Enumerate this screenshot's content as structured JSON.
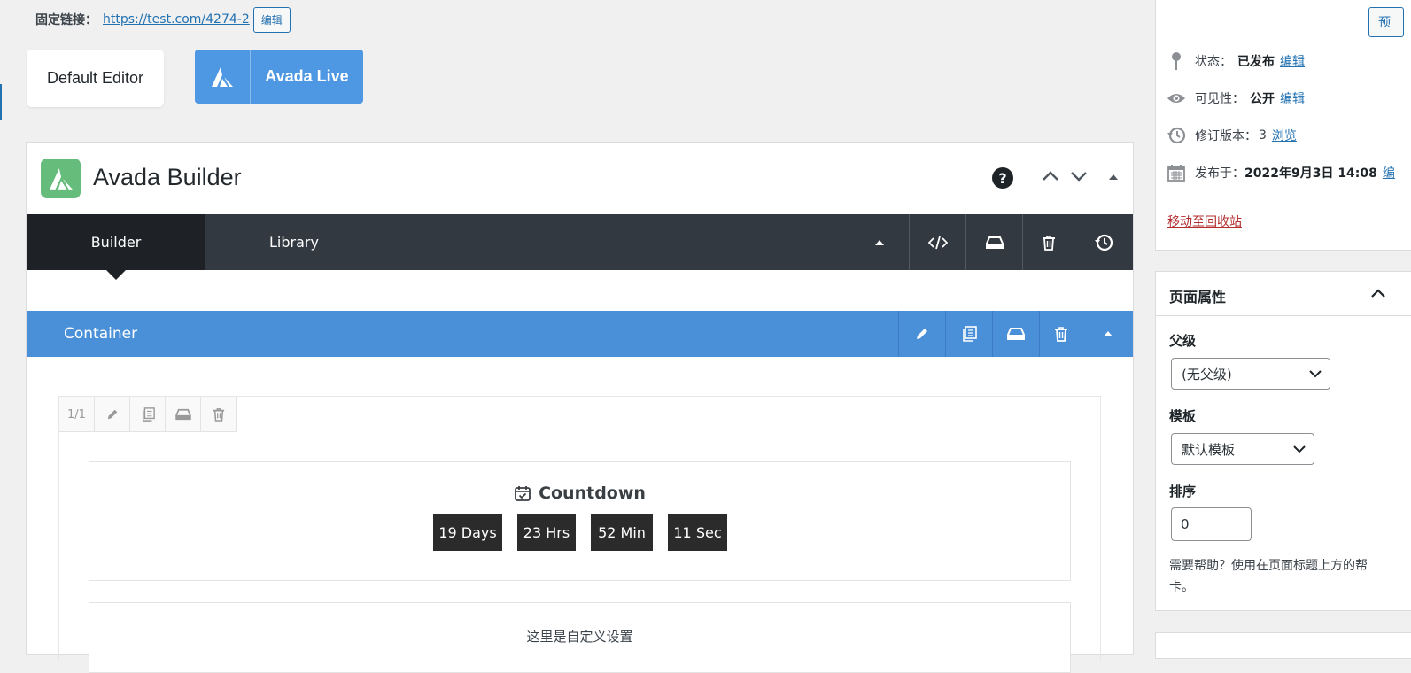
{
  "permalink": {
    "label": "固定链接：",
    "url": "https://test.com/4274-2",
    "edit": "编辑"
  },
  "editor_switch": {
    "default_editor": "Default Editor",
    "avada_live": "Avada Live"
  },
  "builder": {
    "title": "Avada Builder",
    "help": "?",
    "tabs": [
      "Builder",
      "Library"
    ],
    "container_label": "Container",
    "column_size": "1/1"
  },
  "countdown": {
    "title": "Countdown",
    "days": "19 Days",
    "hours": "23 Hrs",
    "minutes": "52 Min",
    "seconds": "11 Sec"
  },
  "custom_element": {
    "text": "这里是自定义设置"
  },
  "publish": {
    "preview": "预",
    "status_label": "状态：",
    "status_value": "已发布",
    "status_edit": "编辑",
    "visibility_label": "可见性：",
    "visibility_value": "公开",
    "visibility_edit": "编辑",
    "revisions_label": "修订版本：",
    "revisions_count": "3",
    "revisions_browse": "浏览",
    "published_label": "发布于：",
    "published_value": "2022年9月3日 14:08",
    "published_edit": "编",
    "trash": "移动至回收站"
  },
  "page_attributes": {
    "title": "页面属性",
    "parent_label": "父级",
    "parent_value": "(无父级)",
    "template_label": "模板",
    "template_value": "默认模板",
    "order_label": "排序",
    "order_value": "0",
    "help_line1": "需要帮助？使用在页面标题上方的帮",
    "help_line2": "卡。"
  },
  "colors": {
    "accent_blue": "#4a90d9",
    "avada_green": "#65bc7b",
    "dark_bar": "#333940",
    "link": "#2271b1",
    "trash": "#b32d2e"
  }
}
